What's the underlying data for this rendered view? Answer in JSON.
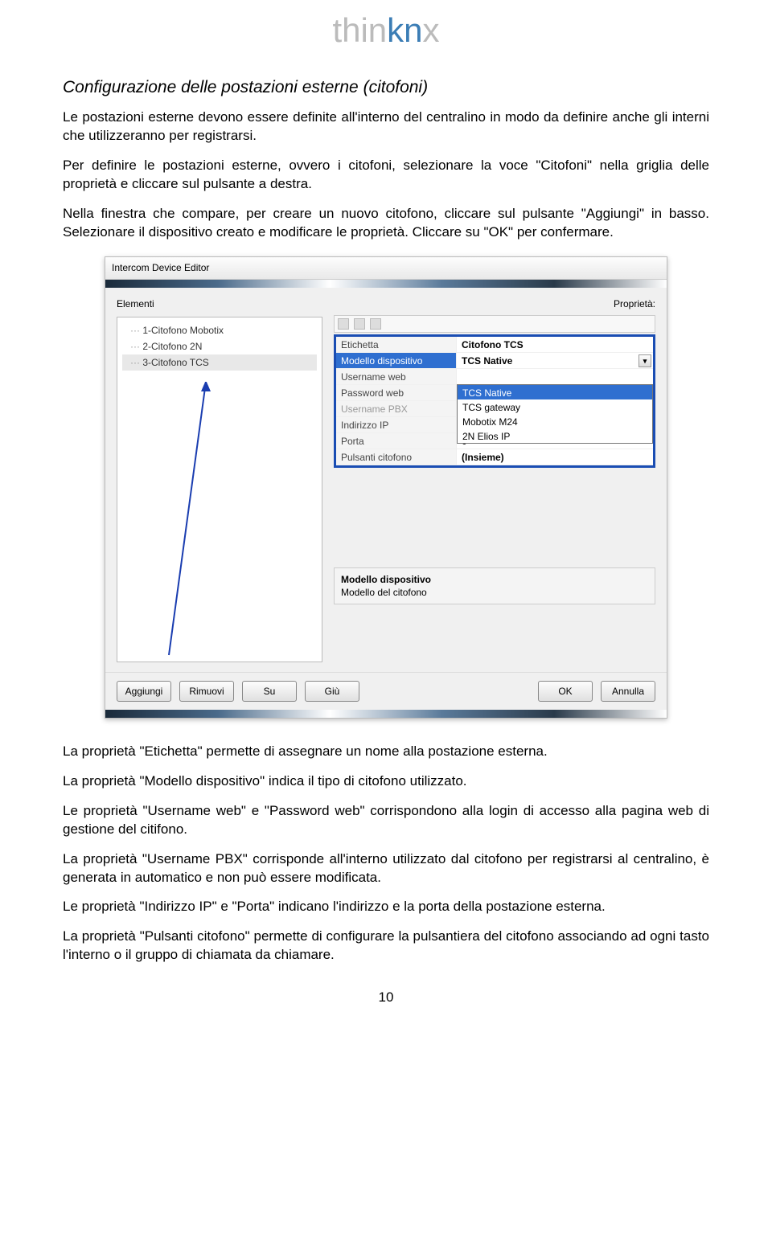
{
  "logo": {
    "part1": "thin",
    "part2": "kn",
    "part3": "x"
  },
  "section_title": "Configurazione delle postazioni esterne (citofoni)",
  "para1": "Le postazioni esterne devono essere definite all'interno del centralino in modo da definire anche gli interni che utilizzeranno per registrarsi.",
  "para2": "Per definire le postazioni esterne, ovvero i citofoni, selezionare la voce \"Citofoni\" nella griglia delle proprietà e cliccare sul pulsante a destra.",
  "para3": "Nella finestra che compare, per creare un nuovo citofono, cliccare sul pulsante \"Aggiungi\" in basso. Selezionare il dispositivo creato e modificare le proprietà. Cliccare su \"OK\" per confermare.",
  "screenshot": {
    "titlebar": "Intercom Device Editor",
    "left_label": "Elementi",
    "right_label": "Proprietà:",
    "tree": [
      "1-Citofono Mobotix",
      "2-Citofono 2N",
      "3-Citofono TCS"
    ],
    "props": [
      {
        "label": "Etichetta",
        "value": "Citofono TCS",
        "bold": true
      },
      {
        "label": "Modello dispositivo",
        "value": "TCS Native",
        "bold": true,
        "selected": true,
        "dropdown": true
      },
      {
        "label": "Username web",
        "value": ""
      },
      {
        "label": "Password web",
        "value": ""
      },
      {
        "label": "Username PBX",
        "value": "",
        "dim": true
      },
      {
        "label": "Indirizzo IP",
        "value": ""
      },
      {
        "label": "Porta",
        "value": "0"
      },
      {
        "label": "Pulsanti citofono",
        "value": "(Insieme)",
        "bold": true
      }
    ],
    "dropdown_options": [
      "TCS Native",
      "TCS gateway",
      "Mobotix M24",
      "2N Elios IP"
    ],
    "desc_title": "Modello dispositivo",
    "desc_text": "Modello del citofono",
    "buttons_left": [
      "Aggiungi",
      "Rimuovi",
      "Su",
      "Giù"
    ],
    "buttons_right": [
      "OK",
      "Annulla"
    ]
  },
  "para4": "La proprietà \"Etichetta\" permette di assegnare un nome alla postazione esterna.",
  "para5": "La proprietà \"Modello dispositivo\" indica il tipo di citofono utilizzato.",
  "para6": "Le proprietà \"Username web\" e \"Password web\" corrispondono alla login di accesso alla pagina web di gestione del citifono.",
  "para7": "La proprietà \"Username PBX\" corrisponde all'interno utilizzato dal citofono per registrarsi al centralino, è generata in automatico e non può essere modificata.",
  "para8": "Le proprietà \"Indirizzo IP\" e \"Porta\" indicano l'indirizzo e la porta della postazione esterna.",
  "para9": "La proprietà \"Pulsanti citofono\" permette di configurare la pulsantiera del citofono associando ad ogni tasto l'interno o il gruppo di chiamata da chiamare.",
  "page_number": "10"
}
